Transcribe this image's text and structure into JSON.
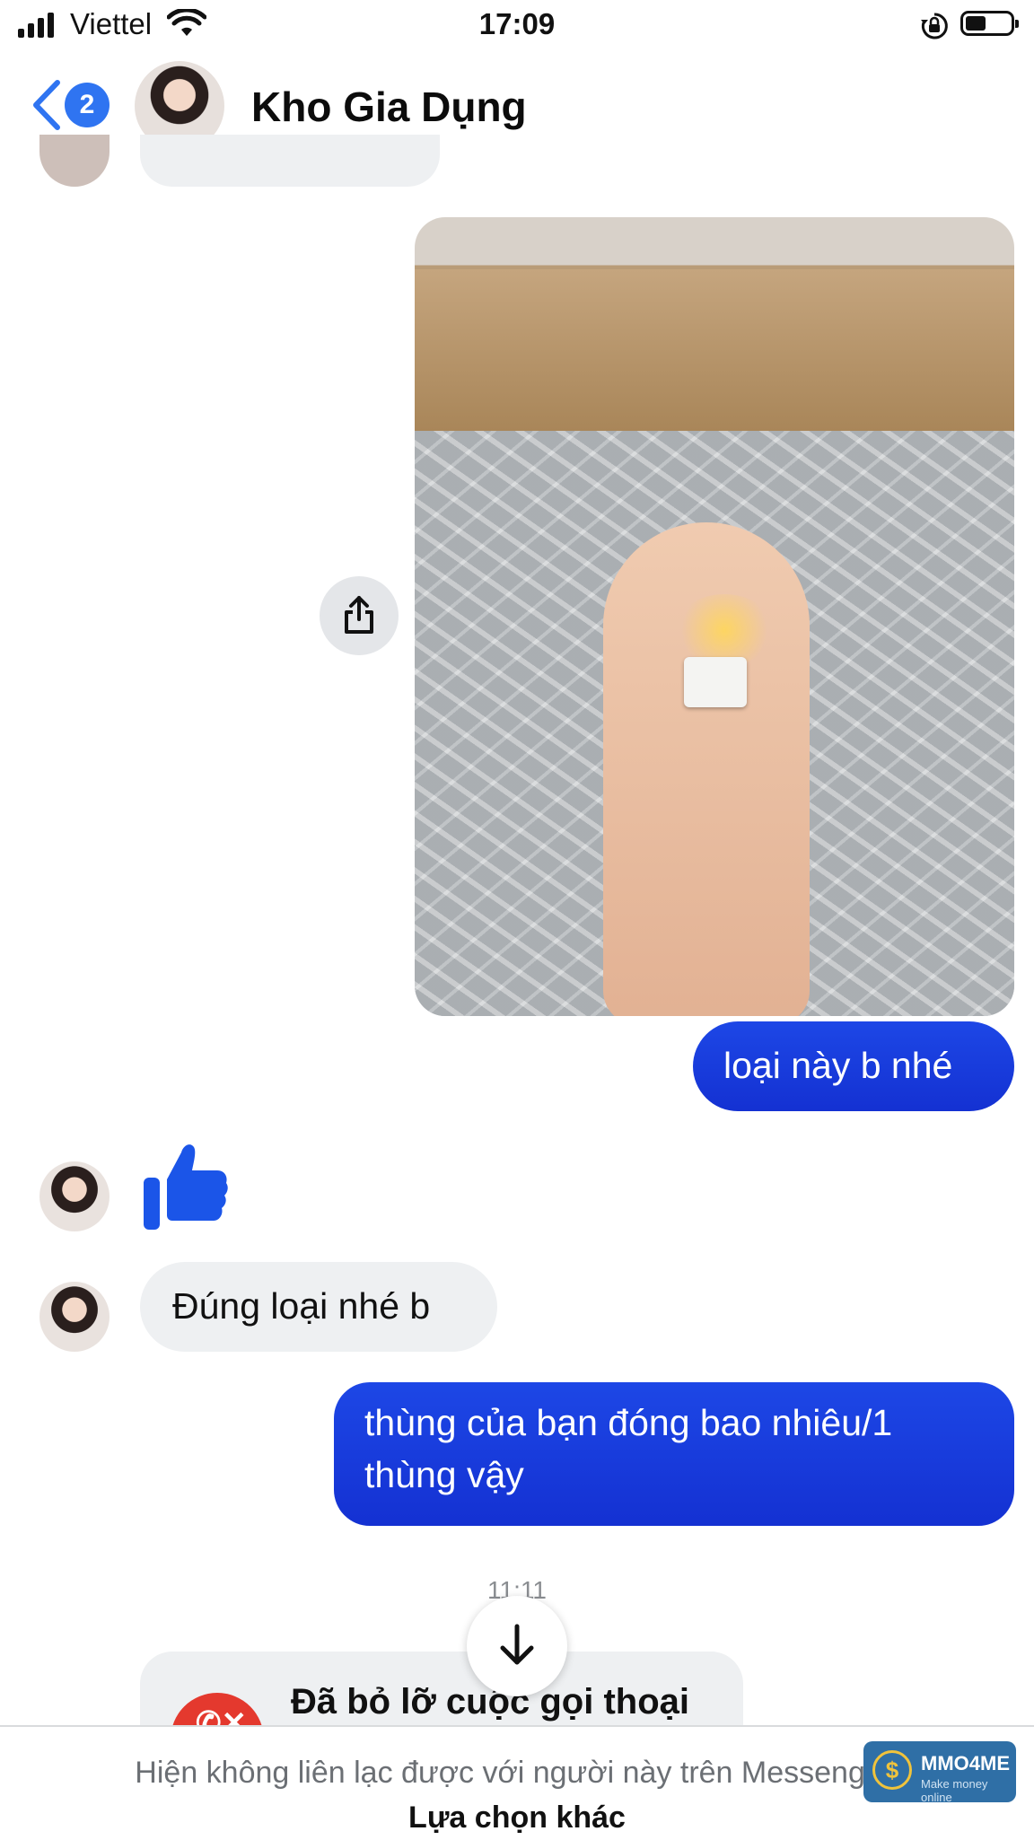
{
  "status_bar": {
    "carrier": "Viettel",
    "time": "17:09",
    "battery_level": 0.45
  },
  "header": {
    "back_count": "2",
    "contact_name": "Kho Gia Dụng"
  },
  "messages": [
    {
      "from": "me",
      "type": "image"
    },
    {
      "from": "me",
      "type": "text",
      "text": "loại này b nhé"
    },
    {
      "from": "them",
      "type": "like"
    },
    {
      "from": "them",
      "type": "text",
      "text": "Đúng loại nhé b"
    },
    {
      "from": "me",
      "type": "text",
      "text_line1": "thùng của bạn đóng bao nhiêu/1",
      "text_line2": "thùng vậy"
    }
  ],
  "timestamp": "11:11",
  "missed_call": {
    "text": "Đã bỏ lỡ cuộc gọi thoại"
  },
  "footer": {
    "unavailable_text": "Hiện không liên lạc được với người này trên Messenger.",
    "other_options": "Lựa chọn khác"
  },
  "watermark": {
    "name": "MMO4ME",
    "tagline": "Make money online"
  },
  "colors": {
    "outgoing_bubble": "#1d47e6",
    "incoming_bubble": "#eef0f2",
    "accent": "#2f74f1",
    "missed_call": "#e4392e"
  }
}
